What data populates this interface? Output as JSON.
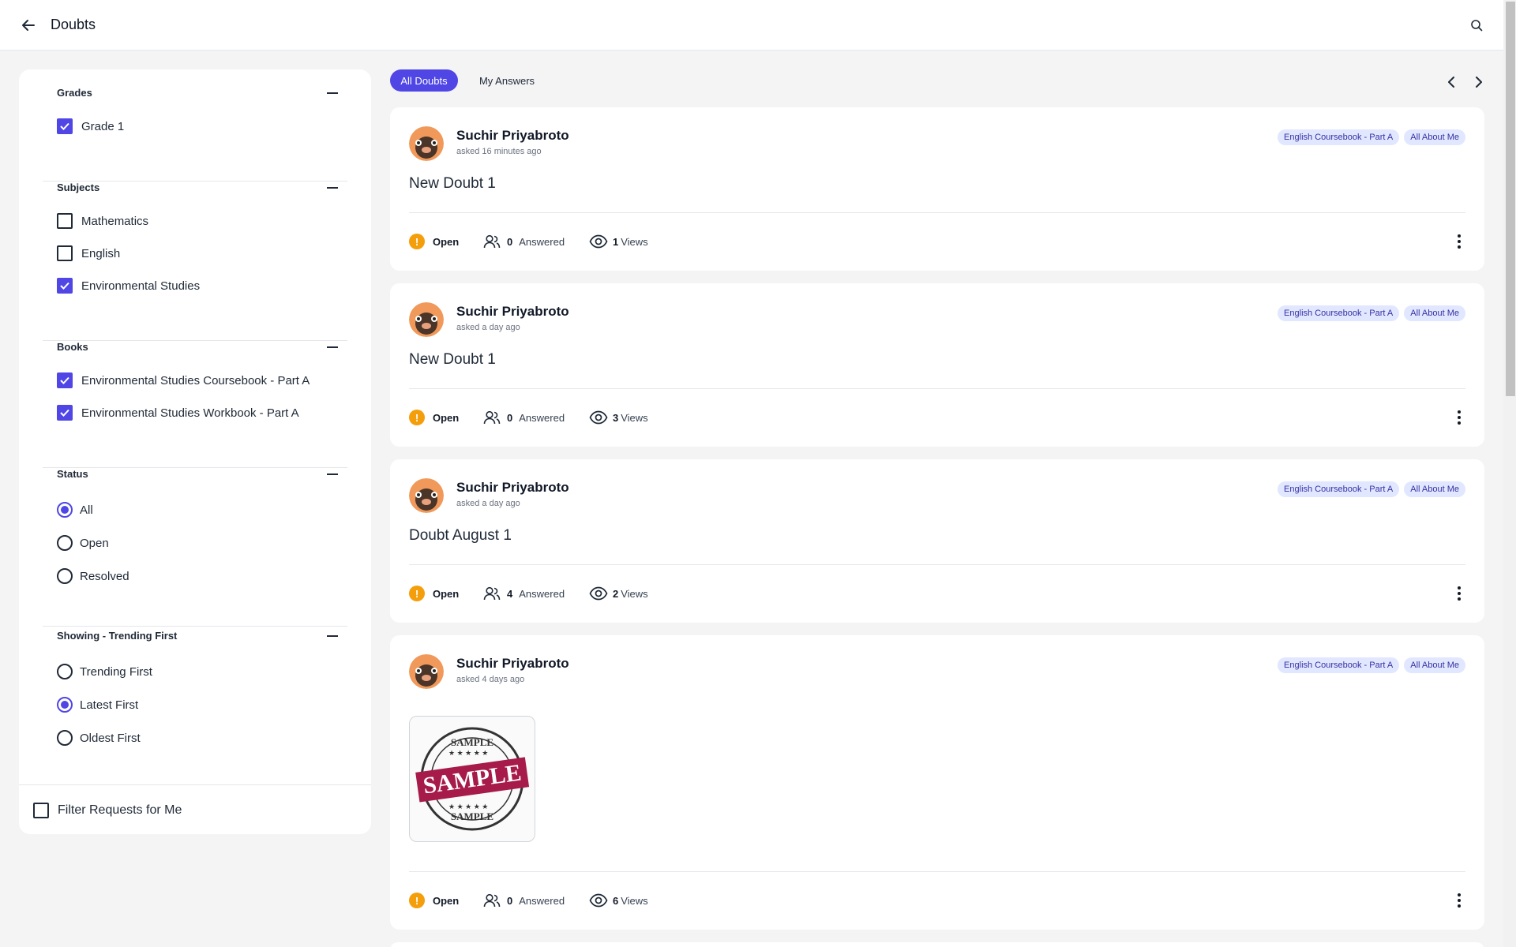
{
  "header": {
    "title": "Doubts"
  },
  "sidebar": {
    "sections": [
      {
        "title": "Grades",
        "options": [
          {
            "label": "Grade 1",
            "checked": true
          }
        ]
      },
      {
        "title": "Subjects",
        "options": [
          {
            "label": "Mathematics",
            "checked": false
          },
          {
            "label": "English",
            "checked": false
          },
          {
            "label": "Environmental Studies",
            "checked": true
          }
        ]
      },
      {
        "title": "Books",
        "options": [
          {
            "label": "Environmental Studies Coursebook - Part A",
            "checked": true
          },
          {
            "label": "Environmental Studies Workbook - Part A",
            "checked": true
          }
        ]
      },
      {
        "title": "Status",
        "options": [
          {
            "label": "All",
            "selected": true
          },
          {
            "label": "Open",
            "selected": false
          },
          {
            "label": "Resolved",
            "selected": false
          }
        ]
      },
      {
        "title": "Showing - Trending First",
        "options": [
          {
            "label": "Trending First",
            "selected": false
          },
          {
            "label": "Latest First",
            "selected": true
          },
          {
            "label": "Oldest First",
            "selected": false
          }
        ]
      }
    ],
    "filter_me": {
      "label": "Filter Requests for Me",
      "checked": false
    }
  },
  "tabs": [
    {
      "label": "All Doubts",
      "active": true
    },
    {
      "label": "My Answers",
      "active": false
    }
  ],
  "doubts": [
    {
      "author": "Suchir Priyabroto",
      "asked": "asked 16 minutes ago",
      "tags": [
        "English Coursebook - Part A",
        "All About Me"
      ],
      "title": "New Doubt 1",
      "status": "Open",
      "answered_count": "0",
      "answered_label": "Answered",
      "views_count": "1",
      "views_label": "Views"
    },
    {
      "author": "Suchir Priyabroto",
      "asked": "asked a day ago",
      "tags": [
        "English Coursebook - Part A",
        "All About Me"
      ],
      "title": "New Doubt 1",
      "status": "Open",
      "answered_count": "0",
      "answered_label": "Answered",
      "views_count": "3",
      "views_label": "Views"
    },
    {
      "author": "Suchir Priyabroto",
      "asked": "asked a day ago",
      "tags": [
        "English Coursebook - Part A",
        "All About Me"
      ],
      "title": "Doubt August 1",
      "status": "Open",
      "answered_count": "4",
      "answered_label": "Answered",
      "views_count": "2",
      "views_label": "Views"
    },
    {
      "author": "Suchir Priyabroto",
      "asked": "asked 4 days ago",
      "tags": [
        "English Coursebook - Part A",
        "All About Me"
      ],
      "attachment_text": {
        "top": "SAMPLE",
        "center": "SAMPLE",
        "bottom": "SAMPLE"
      },
      "status": "Open",
      "answered_count": "0",
      "answered_label": "Answered",
      "views_count": "6",
      "views_label": "Views"
    }
  ],
  "colors": {
    "accent": "#4f46e5",
    "status_open": "#f59e0b",
    "tag_bg": "#e0e7ff",
    "stamp": "#a61b4a"
  }
}
